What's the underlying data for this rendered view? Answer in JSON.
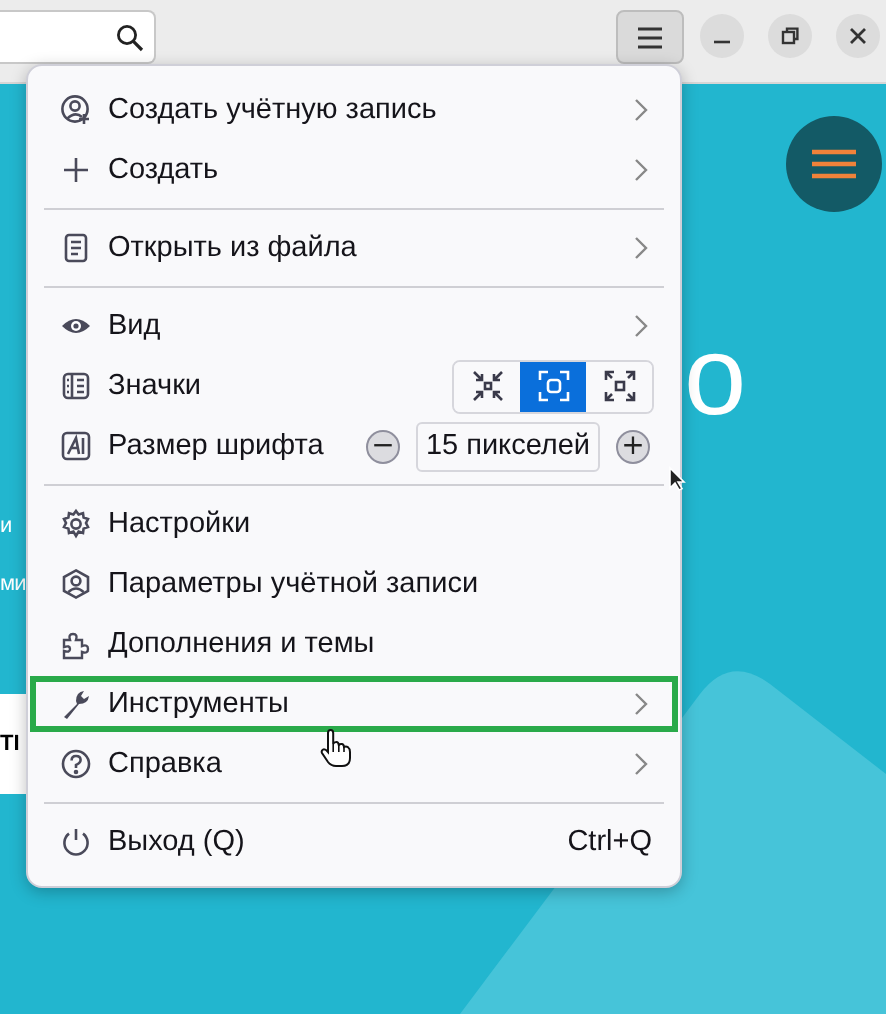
{
  "page": {
    "heading_fragment": "о",
    "text_fragments": [
      "и",
      "ми"
    ],
    "card_fragment": "ТІ"
  },
  "menu": [
    {
      "kind": "item",
      "label": "Создать учётную запись",
      "submenu": true,
      "outlined": false
    },
    {
      "kind": "item",
      "label": "Создать",
      "submenu": true,
      "outlined": false
    },
    {
      "kind": "separator"
    },
    {
      "kind": "item",
      "label": "Открыть из файла",
      "submenu": true,
      "outlined": false
    },
    {
      "kind": "separator"
    },
    {
      "kind": "item",
      "label": "Вид",
      "submenu": true,
      "outlined": false
    },
    {
      "kind": "zoom",
      "label": "Значки",
      "options": [
        {
          "selected": false
        },
        {
          "selected": true
        },
        {
          "selected": false
        }
      ]
    },
    {
      "kind": "font_size",
      "label": "Размер шрифта",
      "value": "15 пикселей",
      "minus": "−",
      "plus": "+"
    },
    {
      "kind": "separator"
    },
    {
      "kind": "item",
      "label": "Настройки",
      "submenu": false,
      "outlined": false
    },
    {
      "kind": "item",
      "label": "Параметры учётной записи",
      "submenu": false,
      "outlined": false
    },
    {
      "kind": "item",
      "label": "Дополнения и темы",
      "submenu": false,
      "outlined": false
    },
    {
      "kind": "item",
      "label": "Инструменты",
      "submenu": true,
      "outlined": true
    },
    {
      "kind": "item",
      "label": "Справка",
      "submenu": true,
      "outlined": false
    },
    {
      "kind": "separator"
    },
    {
      "kind": "item",
      "label": "Выход (Q)",
      "submenu": false,
      "outlined": false,
      "shortcut": "Ctrl+Q"
    }
  ]
}
